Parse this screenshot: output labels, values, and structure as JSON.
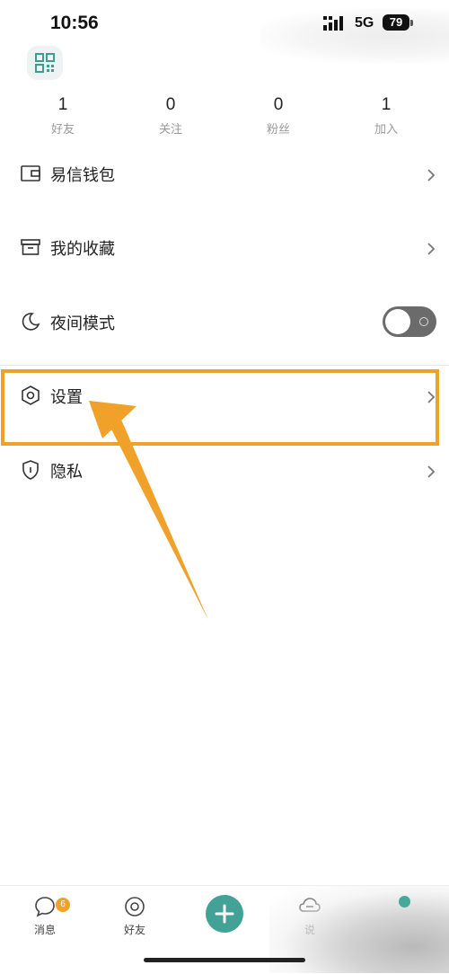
{
  "status_bar": {
    "time": "10:56",
    "network": "5G",
    "battery": "79"
  },
  "stats": [
    {
      "value": "1",
      "label": "好友"
    },
    {
      "value": "0",
      "label": "关注"
    },
    {
      "value": "0",
      "label": "粉丝"
    },
    {
      "value": "1",
      "label": "加入"
    }
  ],
  "menu": {
    "wallet": "易信钱包",
    "favorites": "我的收藏",
    "night_mode": "夜间模式",
    "night_mode_enabled": false,
    "settings": "设置",
    "privacy": "隐私"
  },
  "annotation": {
    "highlight_color": "#f0a12a"
  },
  "tab_bar": {
    "messages": {
      "label": "消息",
      "badge": "6"
    },
    "friends": {
      "label": "好友"
    },
    "third": {
      "label": "说"
    }
  },
  "colors": {
    "accent": "#42a295",
    "highlight": "#f0a12a",
    "toggle_off": "#6b6b6b"
  }
}
